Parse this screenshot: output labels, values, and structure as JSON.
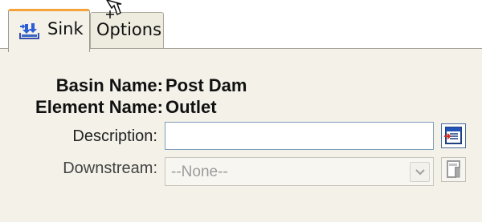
{
  "tabs": [
    {
      "label": "Sink",
      "icon": "sink-tab-icon",
      "active": true
    },
    {
      "label": "Options",
      "active": false
    }
  ],
  "details": {
    "basin_key": "Basin Name:",
    "basin_value": "Post Dam",
    "element_key": "Element Name:",
    "element_value": "Outlet"
  },
  "fields": {
    "description": {
      "label": "Description:",
      "value": "",
      "placeholder": "",
      "button_icon": "description-editor-icon"
    },
    "downstream": {
      "label": "Downstream:",
      "selected": "--None--",
      "button_icon": "downstream-disabled-icon"
    }
  },
  "colors": {
    "active_tab_accent": "#F4A23A",
    "panel_background": "#F3F1E8",
    "input_border": "#7F9DB9"
  }
}
